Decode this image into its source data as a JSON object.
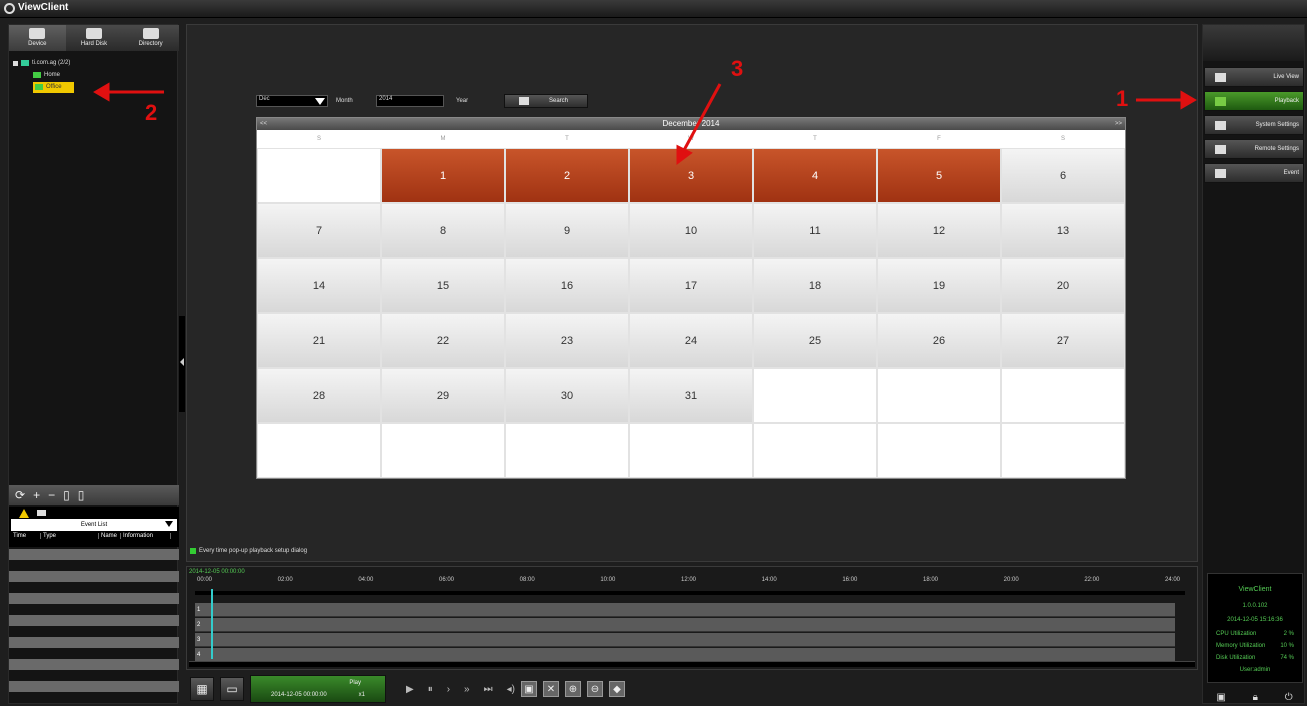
{
  "app": {
    "title": "ViewClient"
  },
  "left_tabs": [
    {
      "label": "Device"
    },
    {
      "label": "Hard Disk"
    },
    {
      "label": "Directory"
    }
  ],
  "tree": {
    "root": "ti.com.ag (2/2)",
    "children": [
      "Home",
      "Office"
    ]
  },
  "event_panel": {
    "list_label": "Event List",
    "columns": [
      "Time",
      "Type",
      "Name",
      "Information"
    ]
  },
  "search": {
    "month_value": "Dec",
    "month_label": "Month",
    "year_value": "2014",
    "year_label": "Year",
    "search_label": "Search"
  },
  "calendar": {
    "title": "December 2014",
    "prev": "<<",
    "next": ">>",
    "dow": [
      "S",
      "M",
      "T",
      "W",
      "T",
      "F",
      "S"
    ],
    "cells": [
      "",
      "1",
      "2",
      "3",
      "4",
      "5",
      "6",
      "7",
      "8",
      "9",
      "10",
      "11",
      "12",
      "13",
      "14",
      "15",
      "16",
      "17",
      "18",
      "19",
      "20",
      "21",
      "22",
      "23",
      "24",
      "25",
      "26",
      "27",
      "28",
      "29",
      "30",
      "31",
      "",
      "",
      "",
      "",
      "",
      "",
      "",
      "",
      "",
      ""
    ],
    "recorded_days": [
      1,
      2,
      3,
      4,
      5
    ]
  },
  "popup_option": "Every time pop-up playback setup dialog",
  "timeline": {
    "current": "2014-12-05 00:00:00",
    "ticks": [
      "00:00",
      "02:00",
      "04:00",
      "06:00",
      "08:00",
      "10:00",
      "12:00",
      "14:00",
      "16:00",
      "18:00",
      "20:00",
      "22:00",
      "24:00"
    ],
    "channels": [
      "1",
      "2",
      "3",
      "4"
    ]
  },
  "playback": {
    "play_label": "Play",
    "time": "2014-12-05 00:00:00",
    "speed": "x1"
  },
  "right_menu": [
    {
      "label": "Live View"
    },
    {
      "label": "Playback"
    },
    {
      "label": "System Settings"
    },
    {
      "label": "Remote Settings"
    },
    {
      "label": "Event"
    }
  ],
  "sysinfo": {
    "title": "ViewClient",
    "version": "1.0.0.102",
    "datetime": "2014-12-05 15:16:36",
    "cpu_label": "CPU Utilization",
    "cpu": "2 %",
    "mem_label": "Memory Utilization",
    "mem": "10 %",
    "disk_label": "Disk Utilization",
    "disk": "74 %",
    "user": "User:admin"
  },
  "annotations": [
    "1",
    "2",
    "3"
  ]
}
